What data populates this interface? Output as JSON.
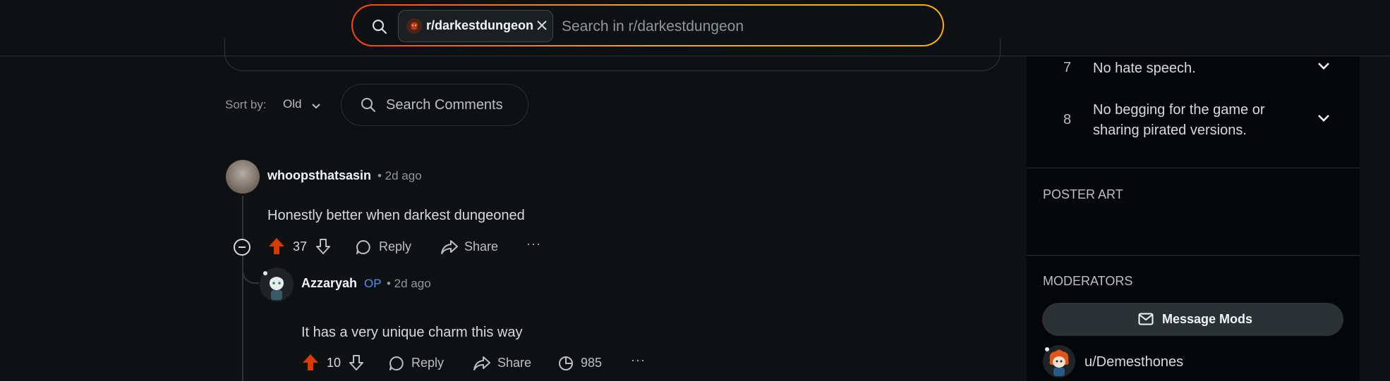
{
  "header": {
    "search": {
      "community_chip": "r/darkestdungeon",
      "placeholder": "Search in r/darkestdungeon"
    }
  },
  "sort": {
    "label": "Sort by:",
    "value": "Old",
    "search_comments_placeholder": "Search Comments"
  },
  "comments": [
    {
      "user": "whoopsthatsasin",
      "time": "• 2d ago",
      "body": "Honestly better when darkest dungeoned",
      "score": "37",
      "reply_label": "Reply",
      "share_label": "Share",
      "more_label": "···"
    },
    {
      "user": "Azzaryah",
      "op_badge": "OP",
      "time": "• 2d ago",
      "body": "It has a very unique charm this way",
      "score": "10",
      "reply_label": "Reply",
      "share_label": "Share",
      "views": "985",
      "more_label": "···"
    }
  ],
  "sidebar": {
    "rules": [
      {
        "number": "7",
        "text": "No hate speech."
      },
      {
        "number": "8",
        "text": "No begging for the game or sharing pirated versions."
      }
    ],
    "poster_art_title": "POSTER ART",
    "moderators_title": "MODERATORS",
    "message_mods_label": "Message Mods",
    "moderators": [
      {
        "name": "u/Demesthones"
      }
    ]
  },
  "colors": {
    "background": "#0e1113",
    "sidebar_background": "#050607",
    "upvote_active": "#d93a00",
    "op_badge": "#5a8cf0",
    "search_border_start": "#ff4500",
    "search_border_end": "#ffb000"
  },
  "icons": {
    "search": "search-icon",
    "close": "close-icon",
    "chevron": "chevron-down-icon",
    "upvote": "upvote-icon",
    "downvote": "downvote-icon",
    "reply": "comment-bubble-icon",
    "share": "share-arrow-icon",
    "views": "views-clock-icon",
    "collapse": "collapse-minus-icon",
    "mail": "mail-icon"
  }
}
